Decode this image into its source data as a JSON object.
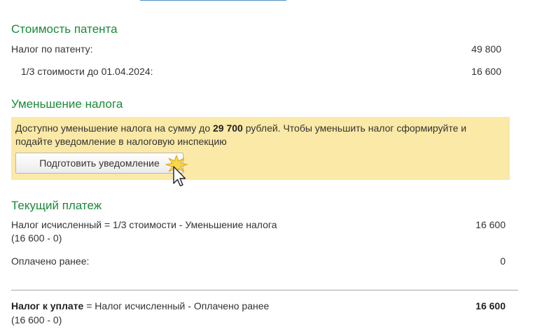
{
  "patent_cost": {
    "title": "Стоимость патента",
    "tax_label": "Налог по патенту:",
    "tax_value": "49 800",
    "third_label": "1/3 стоимости до 01.04.2024:",
    "third_value": "16 600"
  },
  "reduction": {
    "title": "Уменьшение налога",
    "text_before": "Доступно уменьшение налога на сумму до ",
    "amount": "29 700",
    "text_after": " рублей. Чтобы уменьшить налог сформируйте и подайте уведомление в налоговую инспекцию",
    "button_label": "Подготовить уведомление"
  },
  "current_payment": {
    "title": "Текущий платеж",
    "calculated_label": "Налог исчисленный = 1/3 стоимости - Уменьшение налога",
    "calculated_formula": "(16 600 - 0)",
    "calculated_value": "16 600",
    "paid_label": "Оплачено ранее:",
    "paid_value": "0"
  },
  "to_pay": {
    "label_bold": "Налог к уплате",
    "label_rest": " = Налог исчисленный - Оплачено ранее",
    "formula": "(16 600 - 0)",
    "value": "16 600"
  },
  "colors": {
    "section_title": "#1b8a3a",
    "banner_background": "#fbe9a7",
    "top_link_line": "#4a90c8"
  }
}
